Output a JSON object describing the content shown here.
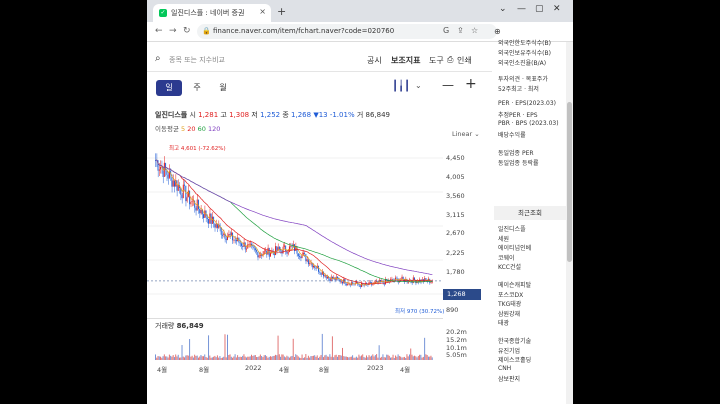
{
  "browser": {
    "tab_title": "일진디스플 : 네이버 증권",
    "tab_close": "×",
    "new_tab": "+",
    "url": "finance.naver.com/item/fchart.naver?code=020760"
  },
  "search": {
    "placeholder": "종목 또는 지수비교"
  },
  "toolbar": {
    "notice": "공시",
    "indicator": "보조지표",
    "tools": "도구",
    "print": "인쇄"
  },
  "periods": [
    {
      "label": "일"
    },
    {
      "label": "주"
    },
    {
      "label": "월"
    }
  ],
  "stock": {
    "name": "일진디스플",
    "open_label": "시",
    "open": "1,281",
    "high_label": "고",
    "high": "1,308",
    "low_label": "저",
    "low": "1,252",
    "close_label": "종",
    "close": "1,268",
    "change": "▼13 -1.01%",
    "volume_label": "거",
    "volume": "86,849"
  },
  "moving_average": {
    "label": "이동평균",
    "ma5": "5",
    "ma20": "20",
    "ma60": "60",
    "ma120": "120"
  },
  "scale_label": "Linear",
  "price_axis": [
    "4,450",
    "4,005",
    "3,560",
    "3,115",
    "2,670",
    "2,225",
    "1,780",
    "890"
  ],
  "current_price": "1,268",
  "high_annotation": "최고 4,601 (-72.62%)",
  "low_annotation": "최저 970 (30.72%)",
  "volume_panel": {
    "label": "거래량",
    "value": "86,849",
    "axis": [
      "20.2m",
      "15.2m",
      "10.1m",
      "5.05m"
    ]
  },
  "x_axis": [
    "4월",
    "8월",
    "2022",
    "4월",
    "8월",
    "2023",
    "4월"
  ],
  "right_panel": {
    "top_items": [
      "외국인한도주식수(B)",
      "외국인보유주식수(B)",
      "외국인소진율(B/A)",
      "투자의견 · 목표주가",
      "52주최고 · 최저",
      "PER · EPS(2023.03)",
      "추정PER · EPS",
      "PBR · BPS (2023.03)",
      "배당수익률",
      "동일업종 PER",
      "동일업종 등락률"
    ],
    "recent_title": "최근조회",
    "recent_items": [
      "일진디스플",
      "세원",
      "에이티넘인베",
      "코웨이",
      "KCC건설",
      "메이슨캐피탈",
      "포스코DX",
      "TKG태광",
      "삼원강재",
      "태광",
      "한국종합기술",
      "유진기업",
      "제이스코홀딩",
      "CNH",
      "삼보판지"
    ]
  },
  "chart_data": {
    "type": "line",
    "title": "",
    "xlabel": "",
    "ylabel": "",
    "x": [
      "4월",
      "8월",
      "2022",
      "4월",
      "8월",
      "2023",
      "4월"
    ],
    "ylim": [
      890,
      4450
    ],
    "series": [
      {
        "name": "",
        "values": [
          4300,
          3300,
          2450,
          1950,
          2100,
          1350,
          1150,
          1300,
          1268
        ]
      }
    ]
  }
}
